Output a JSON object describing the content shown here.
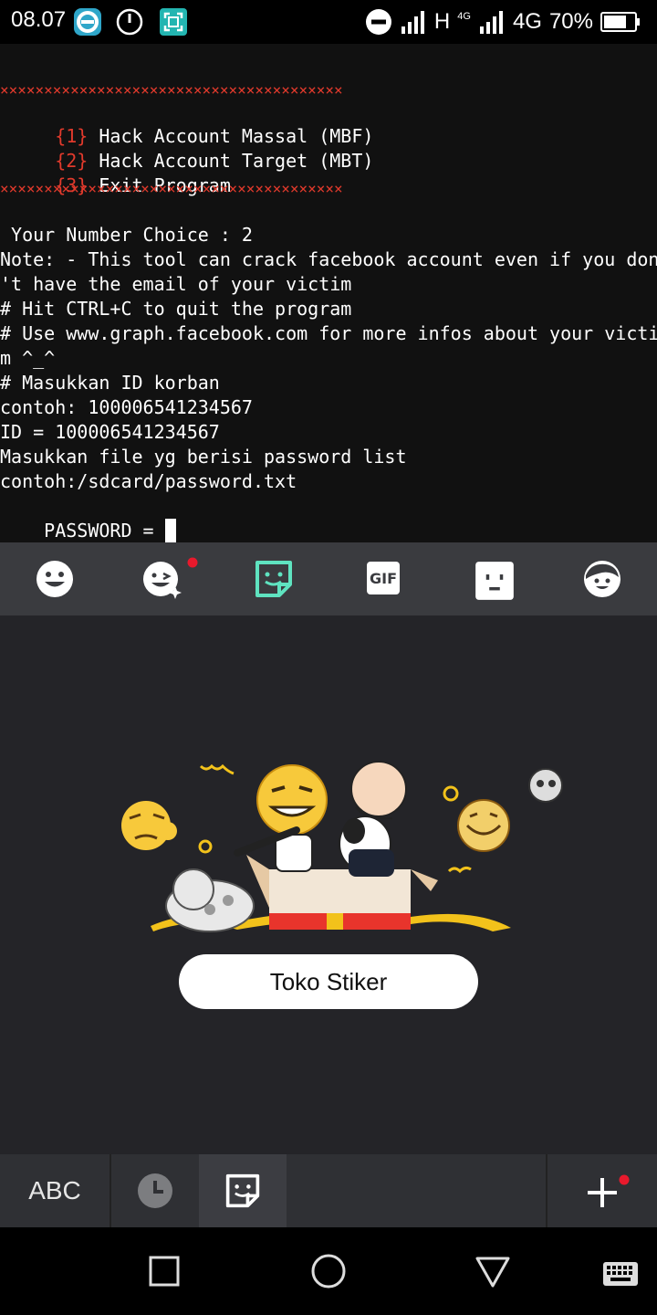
{
  "status_bar": {
    "time": "08.07",
    "network_1": "H",
    "network_2_small": "4G",
    "network_2": "4G",
    "battery": "70%",
    "icons": [
      "esim-app-icon",
      "clock-alarm-icon",
      "screenshot-icon",
      "do-not-disturb-icon",
      "signal-icon",
      "battery-icon"
    ]
  },
  "terminal": {
    "separator": "×××××××××××××××××××××××××××××××××××××××",
    "menu": [
      {
        "num": "{1}",
        "label": " Hack Account Massal (MBF)"
      },
      {
        "num": "{2}",
        "label": " Hack Account Target (MBT)"
      },
      {
        "num": "{3}",
        "label": " Exit Program"
      }
    ],
    "lines": [
      " Your Number Choice : 2",
      "Note: - This tool can crack facebook account even if you don",
      "'t have the email of your victim",
      "# Hit CTRL+C to quit the program",
      "# Use www.graph.facebook.com for more infos about your victi",
      "m ^_^",
      "# Masukkan ID korban",
      "contoh: 100006541234567",
      "ID = 100006541234567",
      "Masukkan file yg berisi password list",
      "contoh:/sdcard/password.txt"
    ],
    "prompt": "PASSWORD = "
  },
  "keyboard": {
    "tabs": [
      "emoji-icon",
      "emoji-new-icon",
      "sticker-icon",
      "gif-icon",
      "kaomoji-icon",
      "avatar-icon"
    ],
    "gif_label": "GIF",
    "store_button": "Toko Stiker",
    "abc_label": "ABC",
    "bottom_icons": [
      "recent-icon",
      "sticker-icon",
      "add-icon"
    ],
    "accent": "#5fe3c0",
    "notify_dot": "#e8192c"
  },
  "nav": {
    "icons": [
      "recents-square-icon",
      "home-circle-icon",
      "back-triangle-icon",
      "keyboard-switch-icon"
    ]
  }
}
